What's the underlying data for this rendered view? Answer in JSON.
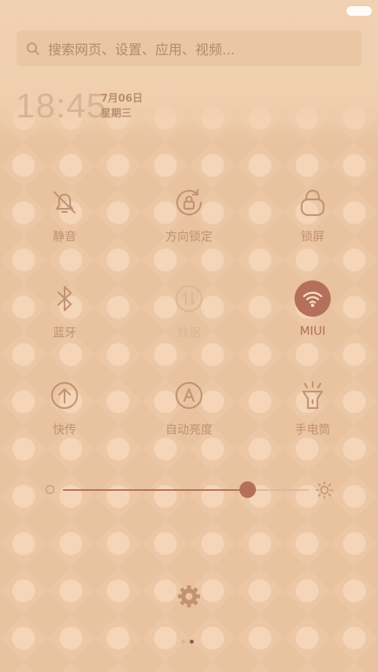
{
  "search": {
    "placeholder": "搜索网页、设置、应用、视频..."
  },
  "clock": {
    "time": "18:45",
    "date": "7月06日",
    "weekday": "星期三"
  },
  "toggles": [
    {
      "label": "静音",
      "icon": "bell-off-icon"
    },
    {
      "label": "方向锁定",
      "icon": "rotation-lock-icon"
    },
    {
      "label": "锁屏",
      "icon": "lock-icon"
    },
    {
      "label": "蓝牙",
      "icon": "bluetooth-icon"
    },
    {
      "label": "数据",
      "icon": "mobile-data-icon"
    },
    {
      "label": "MIUI",
      "icon": "wifi-icon"
    },
    {
      "label": "快传",
      "icon": "upload-icon"
    },
    {
      "label": "自动亮度",
      "icon": "auto-brightness-icon"
    },
    {
      "label": "手电筒",
      "icon": "flashlight-icon"
    }
  ],
  "brightness": {
    "level": 0.75
  },
  "pager": {
    "page_count": 2,
    "current_page": 2
  },
  "colors": {
    "accent": "#b4705a",
    "icon": "#c29373",
    "icon_dim": "#d9b899"
  }
}
